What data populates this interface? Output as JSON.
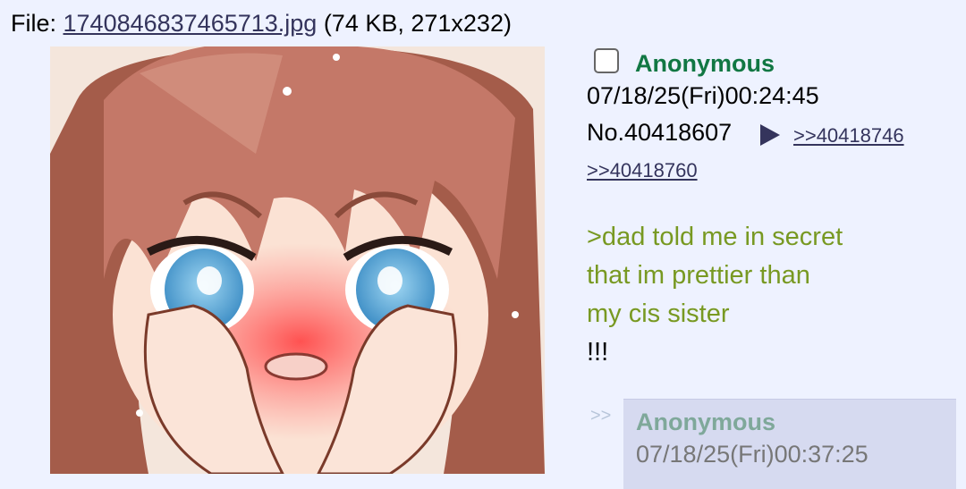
{
  "file": {
    "prefix": "File: ",
    "filename": "1740846837465713.jpg",
    "meta": " (74 KB, 271x232)"
  },
  "post": {
    "name": "Anonymous",
    "datetime": "07/18/25(Fri)00:24:45",
    "number": "No.40418607",
    "backlinks": [
      ">>40418746",
      ">>40418760"
    ],
    "greentext": [
      ">dad told me in secret",
      "that im prettier than",
      "my cis sister"
    ],
    "text": "!!!"
  },
  "reply": {
    "arrows": ">>",
    "name": "Anonymous",
    "datetime": "07/18/25(Fri)00:37:25"
  },
  "colors": {
    "background": "#eef2ff",
    "name_green": "#117743",
    "quote_green": "#789922",
    "link": "#34345c",
    "reply_bg": "#d6daf0"
  },
  "icons": [
    "checkbox-icon",
    "post-menu-arrow-icon"
  ]
}
